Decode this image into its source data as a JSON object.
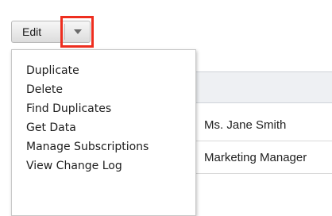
{
  "toolbar": {
    "edit_label": "Edit",
    "dropdown_icon": "chevron-down-icon",
    "highlight_color": "#ee2e1f"
  },
  "actions_menu": {
    "items": [
      {
        "label": "Duplicate"
      },
      {
        "label": "Delete"
      },
      {
        "label": "Find Duplicates"
      },
      {
        "label": "Get Data"
      },
      {
        "label": "Manage Subscriptions"
      },
      {
        "label": "View Change Log"
      }
    ]
  },
  "record": {
    "name": "Ms. Jane Smith",
    "title": "Marketing Manager"
  }
}
